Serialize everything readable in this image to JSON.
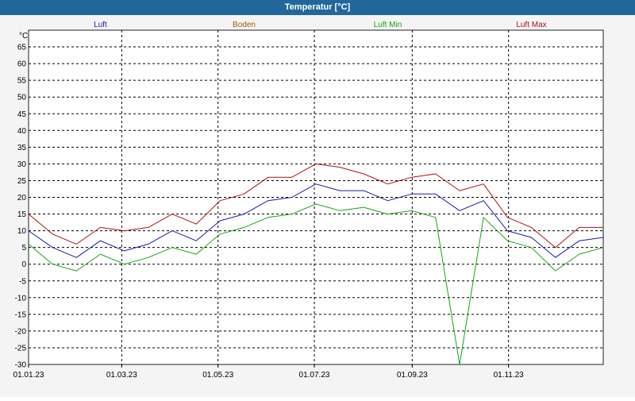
{
  "window": {
    "title": "Temperatur [°C]"
  },
  "chart_data": {
    "type": "line",
    "title": "Temperatur [°C]",
    "ylabel": "°C",
    "ylim": [
      -30,
      70
    ],
    "yticks": [
      65,
      60,
      55,
      50,
      45,
      40,
      35,
      30,
      25,
      20,
      15,
      10,
      5,
      0,
      -5,
      -10,
      -15,
      -20,
      -25,
      -30
    ],
    "xlim_days": [
      0,
      364
    ],
    "xticks": [
      {
        "label": "01.01.23",
        "day": 0
      },
      {
        "label": "01.03.23",
        "day": 59
      },
      {
        "label": "01.05.23",
        "day": 120
      },
      {
        "label": "01.07.23",
        "day": 181
      },
      {
        "label": "01.09.23",
        "day": 243
      },
      {
        "label": "01.11.23",
        "day": 304
      }
    ],
    "grid": true,
    "legend_position": "top",
    "legend": [
      {
        "name": "Luft",
        "color": "#1a1aa8"
      },
      {
        "name": "Boden",
        "color": "#a05a00"
      },
      {
        "name": "Luft Min",
        "color": "#11aa11"
      },
      {
        "name": "Luft Max",
        "color": "#b01010"
      }
    ],
    "x_dates": [
      "01.01.23",
      "15.01.23",
      "01.02.23",
      "15.02.23",
      "01.03.23",
      "15.03.23",
      "01.04.23",
      "15.04.23",
      "01.05.23",
      "15.05.23",
      "01.06.23",
      "15.06.23",
      "01.07.23",
      "15.07.23",
      "01.08.23",
      "15.08.23",
      "01.09.23",
      "15.09.23",
      "01.10.23",
      "15.10.23",
      "01.11.23",
      "15.11.23",
      "01.12.23",
      "15.12.23",
      "31.12.23"
    ],
    "series": [
      {
        "name": "Luft",
        "color": "#1a1aa8",
        "values": [
          10,
          5,
          2,
          7,
          4,
          6,
          10,
          7,
          13,
          15,
          19,
          20,
          24,
          22,
          22,
          19,
          21,
          21,
          16,
          19,
          10,
          8,
          2,
          7,
          8
        ]
      },
      {
        "name": "Luft Min",
        "color": "#11aa11",
        "values": [
          6,
          0,
          -2,
          3,
          0,
          2,
          5,
          3,
          9,
          11,
          14,
          15,
          18,
          16,
          17,
          15,
          16,
          14,
          -30,
          14,
          7,
          5,
          -2,
          3,
          5
        ]
      },
      {
        "name": "Luft Max",
        "color": "#b01010",
        "values": [
          15,
          9,
          6,
          11,
          10,
          11,
          15,
          12,
          19,
          21,
          26,
          26,
          30,
          29,
          27,
          24,
          26,
          27,
          22,
          24,
          14,
          11,
          5,
          11,
          11
        ]
      }
    ]
  }
}
